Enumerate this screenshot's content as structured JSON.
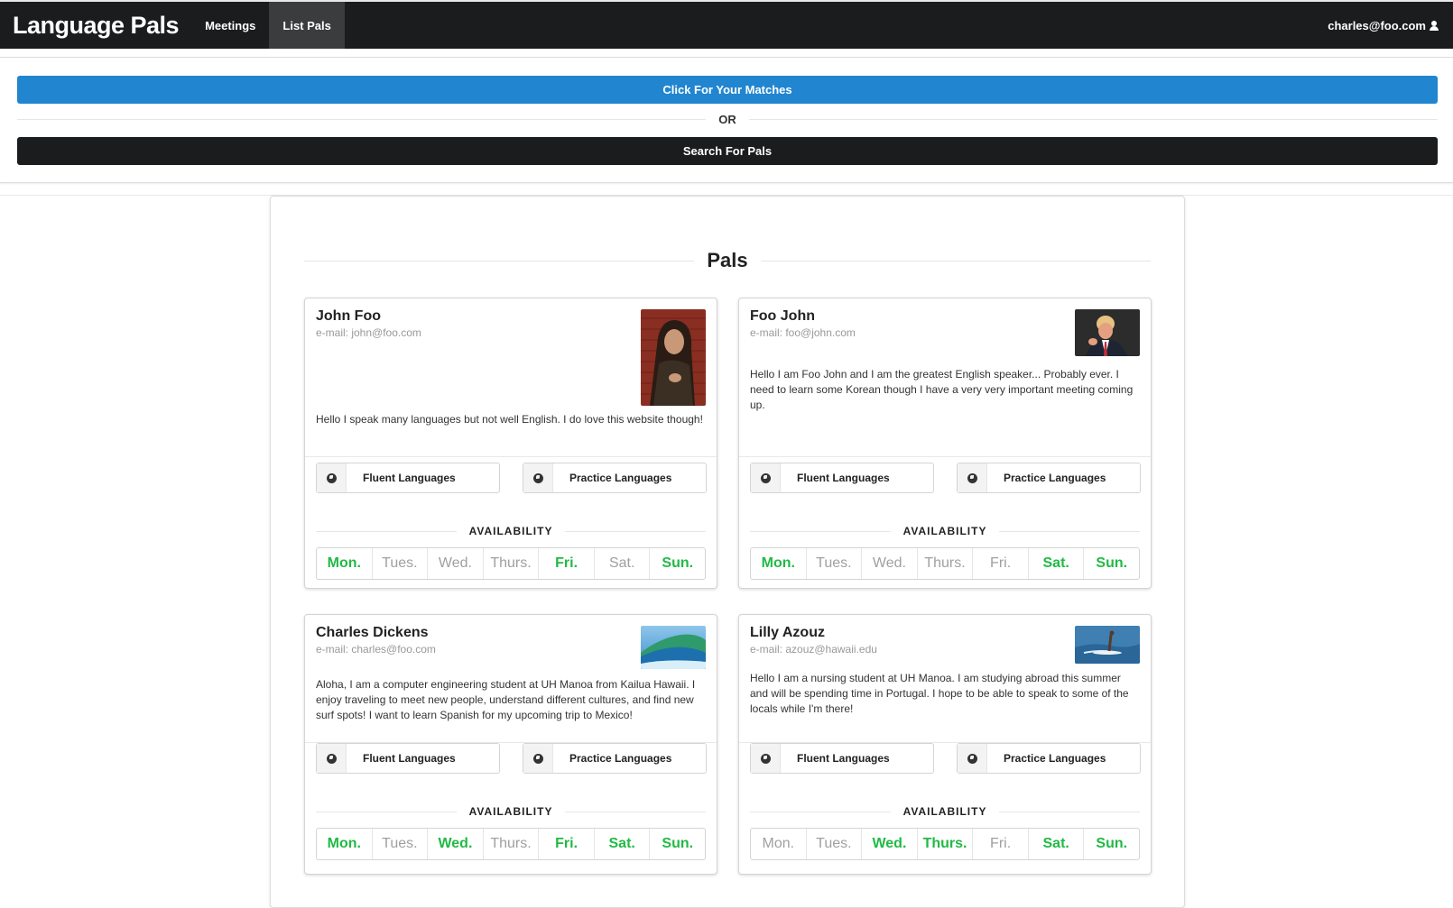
{
  "nav": {
    "brand": "Language Pals",
    "items": [
      "Meetings",
      "List Pals"
    ],
    "user": "charles@foo.com"
  },
  "actions": {
    "matches_label": "Click For Your Matches",
    "or_label": "OR",
    "search_label": "Search For Pals"
  },
  "section_title": "Pals",
  "labels": {
    "fluent": "Fluent Languages",
    "practice": "Practice Languages",
    "availability": "AVAILABILITY"
  },
  "day_labels": [
    "Mon.",
    "Tues.",
    "Wed.",
    "Thurs.",
    "Fri.",
    "Sat.",
    "Sun."
  ],
  "pals": [
    {
      "name": "John Foo",
      "email": "e-mail: john@foo.com",
      "description": "Hello I speak many languages but not well English. I do love this website though!",
      "availability": [
        true,
        false,
        false,
        false,
        true,
        false,
        true
      ]
    },
    {
      "name": "Foo John",
      "email": "e-mail: foo@john.com",
      "description": "Hello I am Foo John and I am the greatest English speaker... Probably ever. I need to learn some Korean though I have a very very important meeting coming up.",
      "availability": [
        true,
        false,
        false,
        false,
        false,
        true,
        true
      ]
    },
    {
      "name": "Charles Dickens",
      "email": "e-mail: charles@foo.com",
      "description": "Aloha, I am a computer engineering student at UH Manoa from Kailua Hawaii. I enjoy traveling to meet new people, understand different cultures, and find new surf spots! I want to learn Spanish for my upcoming trip to Mexico!",
      "availability": [
        true,
        false,
        true,
        false,
        true,
        true,
        true
      ]
    },
    {
      "name": "Lilly Azouz",
      "email": "e-mail: azouz@hawaii.edu",
      "description": "Hello I am a nursing student at UH Manoa. I am studying abroad this summer and will be spending time in Portugal. I hope to be able to speak to some of the locals while I'm there!",
      "availability": [
        false,
        false,
        true,
        true,
        false,
        true,
        true
      ]
    }
  ],
  "colors": {
    "navbar": "#1b1c1d",
    "primary": "#2185d0",
    "available": "#21ba45",
    "unavailable": "#a0a0a0"
  }
}
